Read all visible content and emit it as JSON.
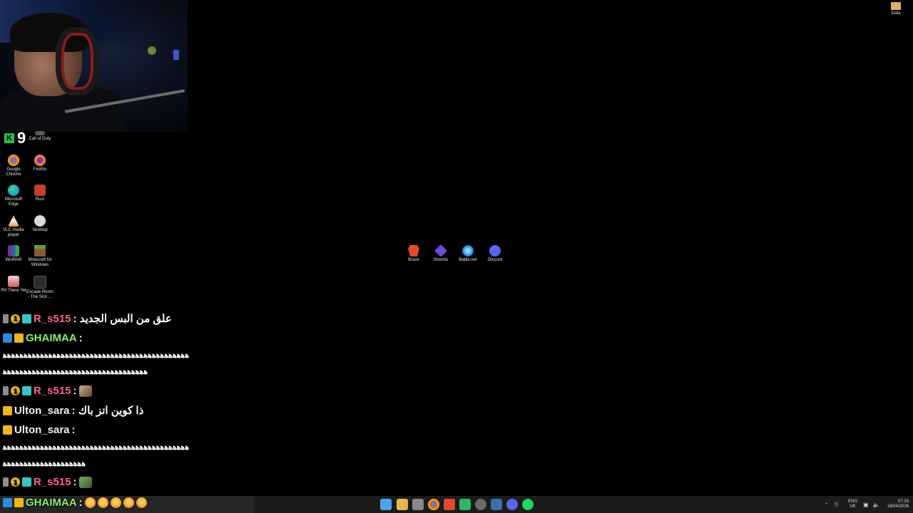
{
  "subscriber_counter": {
    "value": "9"
  },
  "desktop_icons": {
    "top_right": {
      "label": "Data"
    },
    "left_column": [
      {
        "label": "Call of Duty",
        "color": "#5b5b5b"
      },
      {
        "label": "Google\nChrome",
        "color": "#4285f4"
      },
      {
        "label": "Firefox",
        "color": "#ff6d2a"
      },
      {
        "label": "Microsoft\nEdge",
        "color": "#1aa5c7"
      },
      {
        "label": "Rust",
        "color": "#c2402d"
      },
      {
        "label": "VLC media\nplayer",
        "color": "#f08c1a"
      },
      {
        "label": "Vesktop",
        "color": "#b9b9b9"
      },
      {
        "label": "WinRAR",
        "color": "#7a2e8f"
      },
      {
        "label": "Minecraft for\nWindows",
        "color": "#4f8d31"
      },
      {
        "label": "RV There Yet",
        "color": "#c85a5a"
      },
      {
        "label": "Escape Room\n- The Sick ...",
        "color": "#3a3a3a"
      }
    ],
    "center_row": [
      {
        "label": "Brave",
        "color": "#e24a2a"
      },
      {
        "label": "Stremio",
        "color": "#6a4ad6"
      },
      {
        "label": "Battle.net",
        "color": "#1a8ff0"
      },
      {
        "label": "Discord",
        "color": "#5865f2"
      }
    ]
  },
  "chat": {
    "messages": [
      {
        "user": "R_s515",
        "text": ": علق من البس الجديد"
      },
      {
        "user": "GHAIMAA",
        "text": ":"
      },
      {
        "wave": "ﻫﻫﻫﻫﻫﻫﻫﻫﻫﻫﻫﻫﻫﻫﻫﻫﻫﻫﻫﻫﻫﻫﻫﻫﻫﻫﻫﻫﻫﻫﻫﻫﻫﻫﻫﻫﻫﻫﻫﻫﻫﻫﻫﻫﻫ"
      },
      {
        "wave": "ﻫﻫﻫﻫﻫﻫﻫﻫﻫﻫﻫﻫﻫﻫﻫﻫﻫﻫﻫﻫﻫﻫﻫﻫﻫﻫﻫﻫﻫﻫﻫﻫﻫﻫﻫ"
      },
      {
        "user": "R_s515",
        "text": ":"
      },
      {
        "user": "Ulton_sara",
        "text": ": ذا كوين اتز باك"
      },
      {
        "user": "Ulton_sara",
        "text": ":"
      },
      {
        "wave": "ﻫﻫﻫﻫﻫﻫﻫﻫﻫﻫﻫﻫﻫﻫﻫﻫﻫﻫﻫﻫﻫﻫﻫﻫﻫﻫﻫﻫﻫﻫﻫﻫﻫﻫﻫﻫﻫﻫﻫﻫﻫﻫﻫﻫﻫ"
      },
      {
        "wave": "ﻫﻫﻫﻫﻫﻫﻫﻫﻫﻫﻫﻫﻫﻫﻫﻫﻫﻫﻫﻫ"
      },
      {
        "user": "R_s515",
        "text": ":"
      },
      {
        "user": "GHAIMAA",
        "text": ":"
      }
    ]
  },
  "taskbar": {
    "apps": [
      {
        "name": "start-icon",
        "color": "#4aa3f0"
      },
      {
        "name": "file-explorer-icon",
        "color": "#e8b64a"
      },
      {
        "name": "calendar-app-icon",
        "color": "#8a8a8a"
      },
      {
        "name": "chrome-icon",
        "color": "#e8453c"
      },
      {
        "name": "brave-icon",
        "color": "#e24a2a"
      },
      {
        "name": "xbox-app-icon",
        "color": "#2fb566"
      },
      {
        "name": "obs-icon",
        "color": "#6b6b6b"
      },
      {
        "name": "steam-icon",
        "color": "#3a6fa8"
      },
      {
        "name": "discord-icon",
        "color": "#5865f2"
      },
      {
        "name": "spotify-icon",
        "color": "#1ed760"
      }
    ],
    "tray": {
      "language_top": "ENG",
      "language_bottom": "UK",
      "time": "07:33",
      "date": "18/04/2026"
    }
  }
}
